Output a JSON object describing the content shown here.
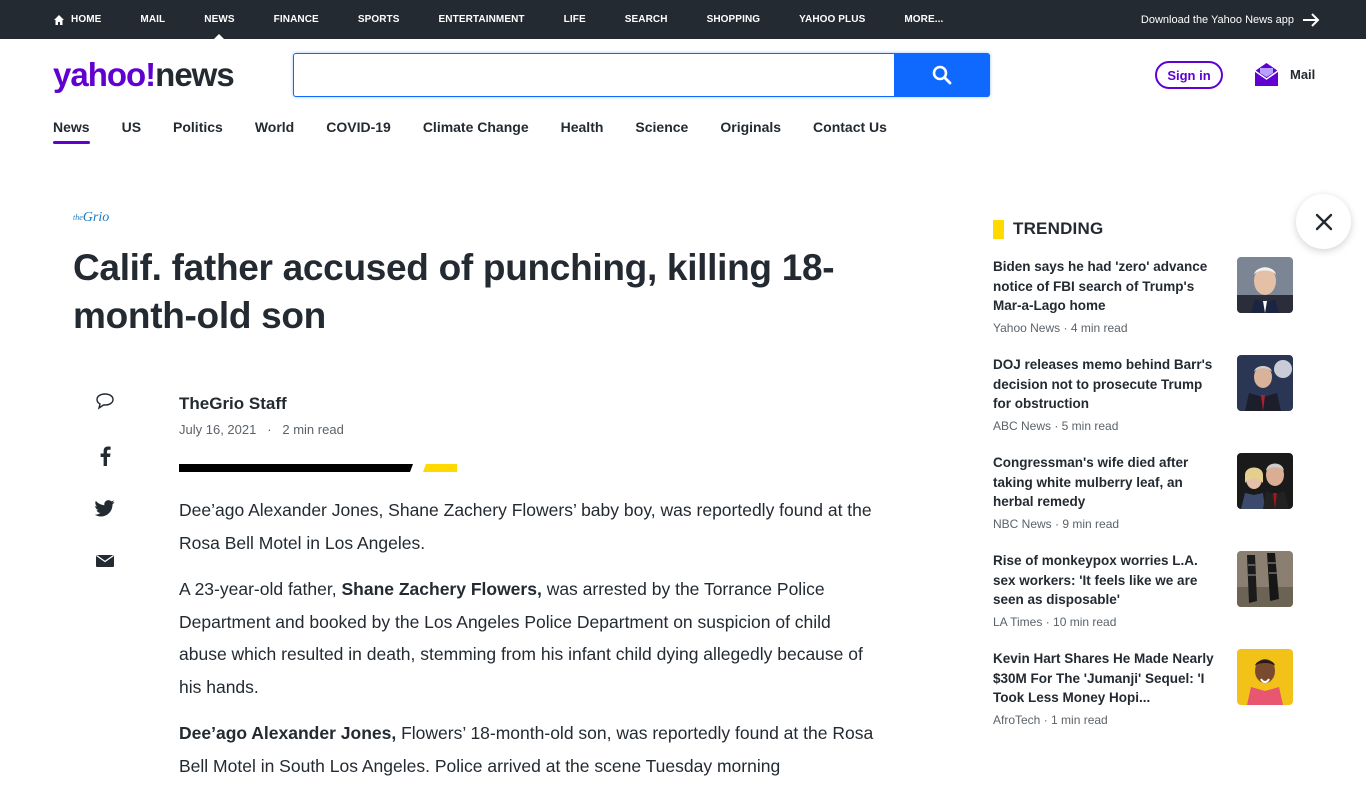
{
  "topnav": {
    "items": [
      "Home",
      "Mail",
      "News",
      "Finance",
      "Sports",
      "Entertainment",
      "Life",
      "Search",
      "Shopping",
      "Yahoo Plus",
      "More..."
    ],
    "download": "Download the Yahoo News app"
  },
  "header": {
    "logo_yahoo": "yahoo!",
    "logo_news": "news",
    "search_placeholder": "",
    "signin": "Sign in",
    "mail": "Mail"
  },
  "subnav": [
    "News",
    "US",
    "Politics",
    "World",
    "COVID-19",
    "Climate Change",
    "Health",
    "Science",
    "Originals",
    "Contact Us"
  ],
  "article": {
    "source_the": "the",
    "source_name": "Grio",
    "headline": "Calif. father accused of punching, killing 18-month-old son",
    "author": "TheGrio Staff",
    "date": "July 16, 2021",
    "read_time": "2 min read",
    "p1": "Dee’ago Alexander Jones, Shane Zachery Flowers’ baby boy, was reportedly found at the Rosa Bell Motel in Los Angeles.",
    "p2_pre": "A 23-year-old father, ",
    "p2_bold": "Shane Zachery Flowers,",
    "p2_post": " was arrested by the Torrance Police Department and booked by the Los Angeles Police Department on suspicion of child abuse which resulted in death, stemming from his infant child dying allegedly because of his hands.",
    "p3_bold": "Dee’ago Alexander Jones,",
    "p3_post": " Flowers’ 18-month-old son, was reportedly found at the Rosa Bell Motel in South Los Angeles. Police arrived at the scene Tuesday morning"
  },
  "trending": {
    "title": "TRENDING",
    "items": [
      {
        "title": "Biden says he had 'zero' advance notice of FBI search of Trump's Mar-a-Lago home",
        "source": "Yahoo News · 4 min read"
      },
      {
        "title": "DOJ releases memo behind Barr's decision not to prosecute Trump for obstruction",
        "source": "ABC News · 5 min read"
      },
      {
        "title": "Congressman's wife died after taking white mulberry leaf, an herbal remedy",
        "source": "NBC News · 9 min read"
      },
      {
        "title": "Rise of monkeypox worries L.A. sex workers: 'It feels like we are seen as disposable'",
        "source": "LA Times · 10 min read"
      },
      {
        "title": "Kevin Hart Shares He Made Nearly $30M For The 'Jumanji' Sequel: 'I Took Less Money Hopi...",
        "source": "AfroTech · 1 min read"
      }
    ]
  },
  "colors": {
    "brand": "#6001d2",
    "accent": "#0f69ff",
    "topbar": "#232a31",
    "trend_bar": "#ffd900"
  }
}
